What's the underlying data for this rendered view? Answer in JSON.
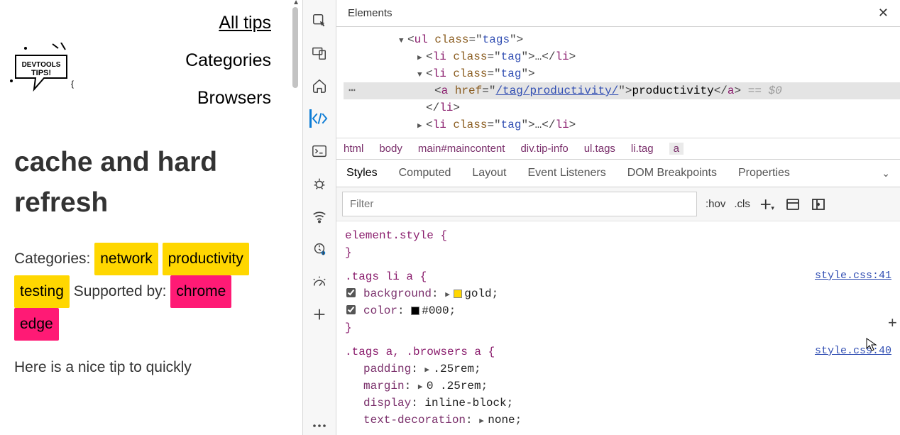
{
  "site": {
    "nav": {
      "all_tips": "All tips",
      "categories": "Categories",
      "browsers": "Browsers"
    },
    "logo_text": "DEVTOOLS TIPS!",
    "title": "cache and hard refresh",
    "categories_label": "Categories:",
    "tags": [
      "network",
      "productivity",
      "testing"
    ],
    "supported_label": "Supported by:",
    "browsers": [
      "chrome",
      "edge"
    ],
    "body": "Here is a nice tip to quickly"
  },
  "devtools": {
    "panel_tab": "Elements",
    "dom": {
      "ul_open": {
        "tag": "ul",
        "attr": "class",
        "val": "tags"
      },
      "li_tag_open": {
        "tag": "li",
        "attr": "class",
        "val": "tag"
      },
      "li_collapsed": "…",
      "a_tag": {
        "tag": "a",
        "attr": "href",
        "val": "/tag/productivity/",
        "text": "productivity"
      },
      "hint": "== $0"
    },
    "breadcrumbs": [
      "html",
      "body",
      "main#maincontent",
      "div.tip-info",
      "ul.tags",
      "li.tag",
      "a"
    ],
    "subtabs": [
      "Styles",
      "Computed",
      "Layout",
      "Event Listeners",
      "DOM Breakpoints",
      "Properties"
    ],
    "filter_placeholder": "Filter",
    "toggles": {
      "hov": ":hov",
      "cls": ".cls"
    },
    "styles": {
      "element_style": "element.style {",
      "rule1": {
        "selector": ".tags li a {",
        "src": "style.css:41",
        "decls": [
          {
            "prop": "background",
            "val": "gold",
            "swatch": "#ffd700",
            "expand": true
          },
          {
            "prop": "color",
            "val": "#000",
            "swatch": "#000000"
          }
        ]
      },
      "rule2": {
        "selector": ".tags a, .browsers a {",
        "src": "style.css:40",
        "decls": [
          {
            "prop": "padding",
            "val": ".25rem",
            "expand": true
          },
          {
            "prop": "margin",
            "val": "0 .25rem",
            "expand": true
          },
          {
            "prop": "display",
            "val": "inline-block"
          },
          {
            "prop": "text-decoration",
            "val": "none",
            "expand": true
          }
        ]
      }
    }
  }
}
